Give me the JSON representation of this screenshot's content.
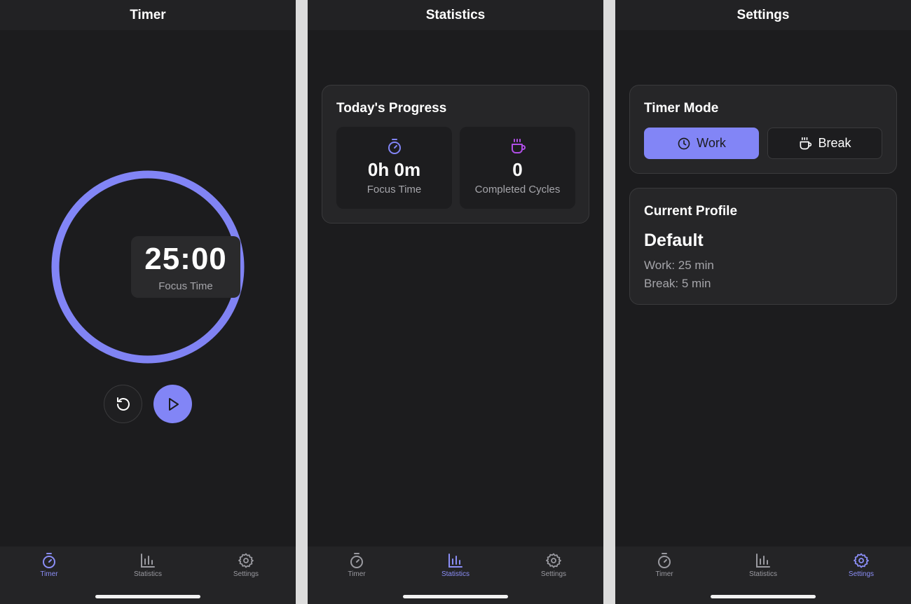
{
  "colors": {
    "accent": "#8285f6",
    "background": "#1c1c1e",
    "card": "#262628",
    "cup_icon": "#b04ee6"
  },
  "timer_screen": {
    "title": "Timer",
    "time_display": "25:00",
    "time_label": "Focus Time",
    "progress_fraction": 1.0,
    "reset_icon": "reset-icon",
    "play_icon": "play-icon"
  },
  "statistics_screen": {
    "title": "Statistics",
    "card_title": "Today's Progress",
    "stats": [
      {
        "icon": "stopwatch-icon",
        "value": "0h 0m",
        "label": "Focus Time"
      },
      {
        "icon": "coffee-cup-icon",
        "value": "0",
        "label": "Completed Cycles"
      }
    ]
  },
  "settings_screen": {
    "title": "Settings",
    "timer_mode": {
      "title": "Timer Mode",
      "options": [
        {
          "label": "Work",
          "icon": "clock-icon",
          "selected": true
        },
        {
          "label": "Break",
          "icon": "coffee-cup-icon",
          "selected": false
        }
      ]
    },
    "profile": {
      "title": "Current Profile",
      "name": "Default",
      "work_line": "Work: 25 min",
      "break_line": "Break: 5 min"
    }
  },
  "tabbar": {
    "items": [
      {
        "label": "Timer",
        "icon": "stopwatch-icon"
      },
      {
        "label": "Statistics",
        "icon": "bar-chart-icon"
      },
      {
        "label": "Settings",
        "icon": "gear-icon"
      }
    ]
  }
}
